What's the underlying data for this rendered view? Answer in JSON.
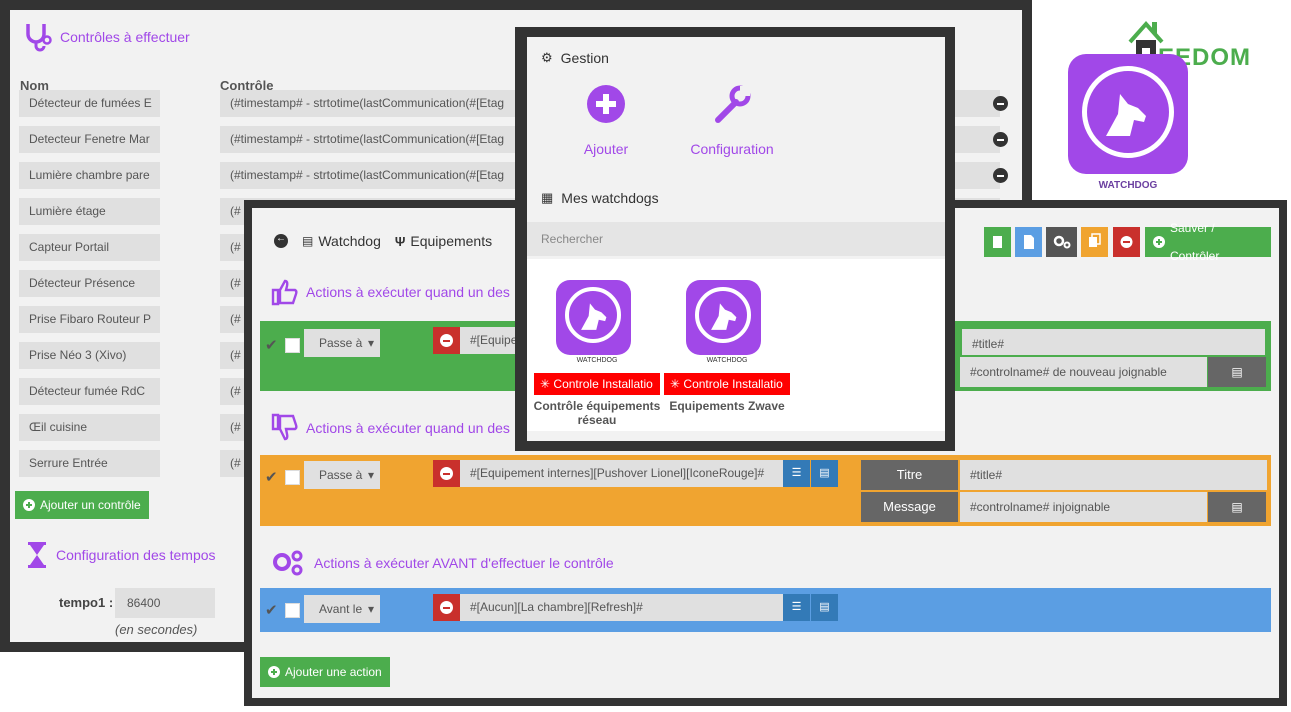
{
  "controls": {
    "title": "Contrôles à effectuer",
    "col_name": "Nom",
    "col_control": "Contrôle",
    "rows": [
      {
        "name": "Détecteur de fumées E",
        "control": "(#timestamp# - strtotime(lastCommunication(#[Etag"
      },
      {
        "name": "Detecteur Fenetre Mar",
        "control": "(#timestamp# - strtotime(lastCommunication(#[Etag"
      },
      {
        "name": "Lumière chambre pare",
        "control": "(#timestamp# - strtotime(lastCommunication(#[Etag"
      },
      {
        "name": "Lumière étage",
        "control": "(#"
      },
      {
        "name": "Capteur Portail",
        "control": "(#"
      },
      {
        "name": "Détecteur Présence",
        "control": "(#"
      },
      {
        "name": "Prise Fibaro Routeur P",
        "control": "(#"
      },
      {
        "name": "Prise Néo 3 (Xivo)",
        "control": "(#"
      },
      {
        "name": "Détecteur fumée RdC",
        "control": "(#"
      },
      {
        "name": "Œil cuisine",
        "control": "(#"
      },
      {
        "name": "Serrure Entrée",
        "control": "(#"
      }
    ],
    "add_label": "Ajouter un contrôle",
    "timing_title": "Configuration des tempos",
    "tempo_label": "tempo1 :",
    "tempo_value": "86400",
    "tempo_unit": "(en secondes)"
  },
  "editor": {
    "toolbar": {
      "watchdog": "Watchdog",
      "equipements": "Equipements"
    },
    "save_label": "Sauver / Contrôler",
    "section1_title": "Actions à exécuter quand un des",
    "section2_title": "Actions à exécuter quand un des",
    "section3_title": "Actions à exécuter AVANT d'effectuer le contrôle",
    "action1": {
      "select": "Passe à",
      "cmd": "#[Equipe",
      "title_value": "#title#",
      "message_value": "#controlname# de nouveau joignable"
    },
    "action2": {
      "select": "Passe à",
      "cmd": "#[Equipement internes][Pushover Lionel][IconeRouge]#",
      "title_label": "Titre",
      "title_value": "#title#",
      "message_label": "Message",
      "message_value": "#controlname# injoignable"
    },
    "action3": {
      "select": "Avant le",
      "cmd": "#[Aucun][La chambre][Refresh]#"
    },
    "add_action": "Ajouter une action"
  },
  "gestion": {
    "title": "Gestion",
    "add_label": "Ajouter",
    "config_label": "Configuration",
    "mine_title": "Mes watchdogs",
    "search_placeholder": "Rechercher",
    "cards": [
      {
        "logo_text": "WATCHDOG",
        "tag": "Controle Installatio",
        "name": "Contrôle équipements réseau"
      },
      {
        "logo_text": "WATCHDOG",
        "tag": "Controle Installatio",
        "name": "Equipements Zwave"
      }
    ]
  },
  "branding": {
    "jeedom_text": "EEDOM",
    "plugin_label": "WATCHDOG"
  },
  "colors": {
    "purple": "#a148e8",
    "green": "#4cad4d",
    "orange": "#f0a430",
    "blue": "#5b9ee3",
    "red": "#ff0000"
  }
}
